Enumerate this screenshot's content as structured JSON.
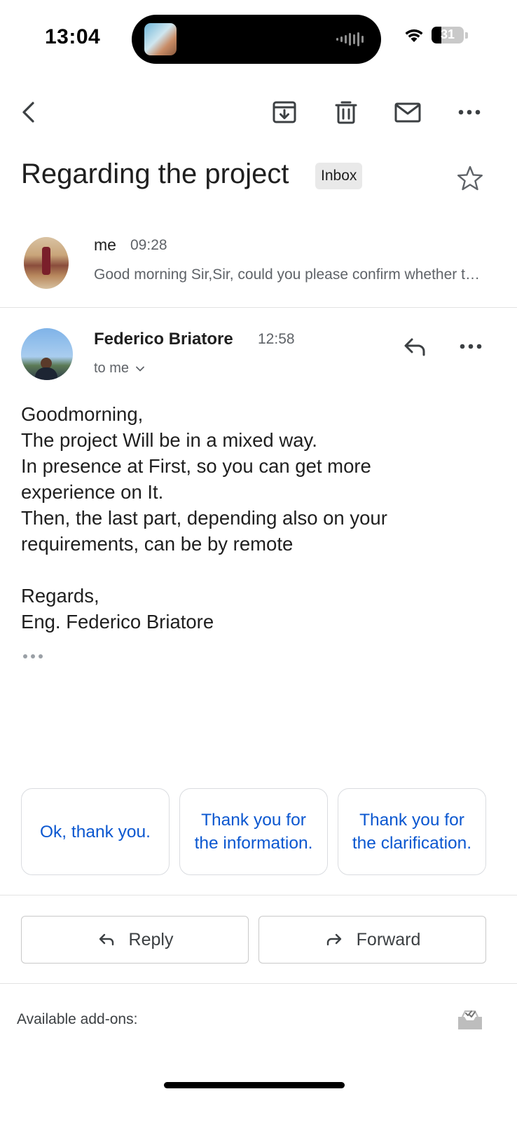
{
  "status_bar": {
    "time": "13:04",
    "battery": "31",
    "battery_level": 0.31
  },
  "toolbar": {
    "back_icon": "chevron-left-icon",
    "archive_icon": "archive-icon",
    "delete_icon": "trash-icon",
    "mark_unread_icon": "mail-icon",
    "more_icon": "more-horizontal-icon"
  },
  "thread": {
    "subject": "Regarding the project",
    "label": "Inbox",
    "star_icon": "star-outline-icon"
  },
  "collapsed_message": {
    "sender": "me",
    "time": "09:28",
    "snippet": "Good morning Sir,Sir, could you please confirm whether the project will be in presence or remote?"
  },
  "expanded_message": {
    "sender": "Federico Briatore",
    "time": "12:58",
    "recipient": "to me",
    "body_lines": [
      "Goodmorning,",
      "The project Will be in a mixed way.",
      "In presence at First, so you can get more",
      "experience on It.",
      "Then, the last part, depending also on your",
      "requirements, can be by remote",
      "",
      "Regards,",
      "Eng. Federico Briatore"
    ]
  },
  "smart_replies": [
    "Ok, thank you.",
    "Thank you for the information.",
    "Thank you for the clarification."
  ],
  "actions": {
    "reply": "Reply",
    "forward": "Forward"
  },
  "addons": {
    "label": "Available add-ons:"
  },
  "colors": {
    "link_blue": "#0b57d0",
    "secondary_text": "#5f6368"
  }
}
